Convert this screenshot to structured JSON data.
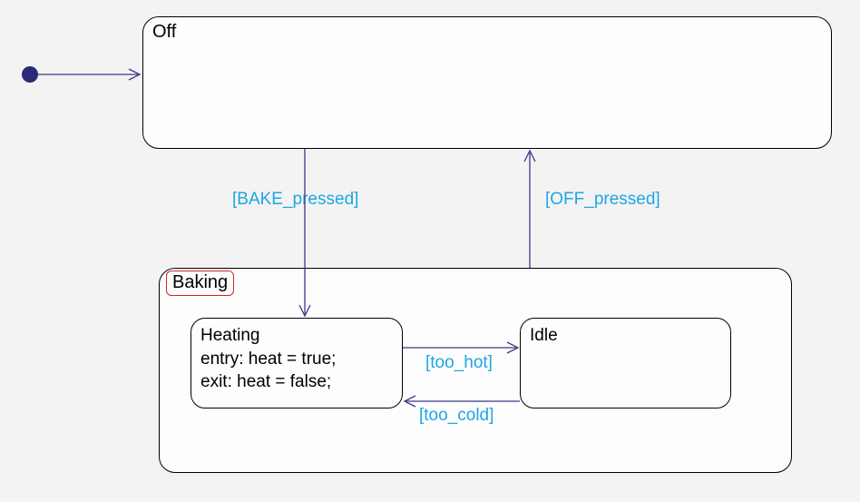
{
  "states": {
    "off": {
      "label": "Off"
    },
    "baking": {
      "label": "Baking"
    },
    "heating": {
      "title": "Heating",
      "entry": "entry: heat = true;",
      "exit": "exit: heat = false;"
    },
    "idle": {
      "title": "Idle"
    }
  },
  "transitions": {
    "bake_pressed": "[BAKE_pressed]",
    "off_pressed": "[OFF_pressed]",
    "too_hot": "[too_hot]",
    "too_cold": "[too_cold]"
  },
  "chart_data": {
    "type": "state_machine",
    "title": "",
    "initial_state": "Off",
    "states": [
      {
        "name": "Off",
        "composite": false
      },
      {
        "name": "Baking",
        "composite": true,
        "substates": [
          {
            "name": "Heating",
            "entry_action": "heat = true;",
            "exit_action": "heat = false;"
          },
          {
            "name": "Idle"
          }
        ]
      }
    ],
    "transitions": [
      {
        "from": "__initial__",
        "to": "Off",
        "guard": null
      },
      {
        "from": "Off",
        "to": "Baking",
        "guard": "BAKE_pressed"
      },
      {
        "from": "Baking",
        "to": "Off",
        "guard": "OFF_pressed"
      },
      {
        "from": "Heating",
        "to": "Idle",
        "guard": "too_hot"
      },
      {
        "from": "Idle",
        "to": "Heating",
        "guard": "too_cold"
      }
    ]
  }
}
